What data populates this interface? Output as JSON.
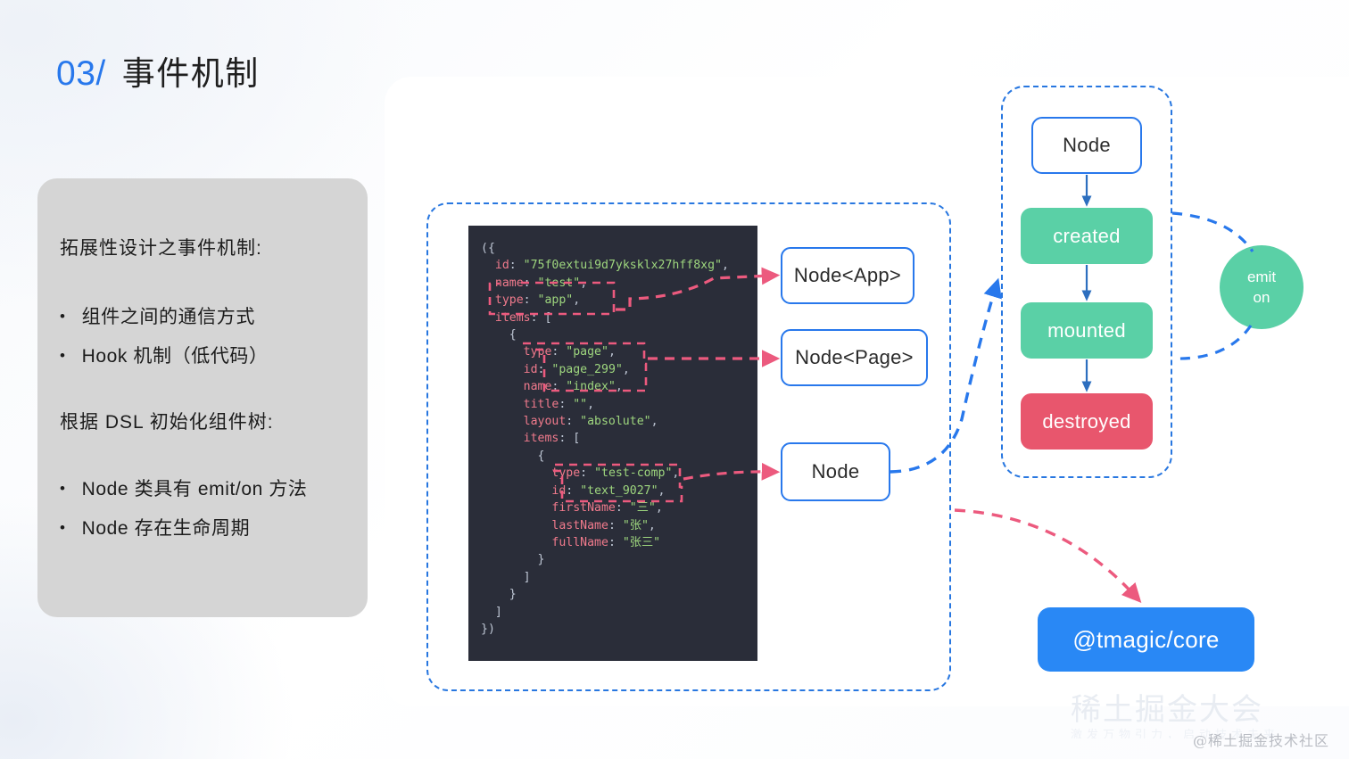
{
  "title": {
    "number": "03/",
    "text": "事件机制",
    "accent": "#2878ec"
  },
  "left_card": {
    "heading_1": "拓展性设计之事件机制:",
    "bullets_1": [
      "组件之间的通信方式",
      "Hook 机制（低代码）"
    ],
    "heading_2": "根据 DSL 初始化组件树:",
    "bullets_2": [
      "Node 类具有 emit/on 方法",
      "Node 存在生命周期"
    ],
    "bullet_glyph": "•"
  },
  "code": {
    "language": "javascript",
    "background": "#2a2d39",
    "key_color": "#f07a8c",
    "string_color": "#9ed67e",
    "punct_color": "#bfc7d5",
    "lines": [
      [
        {
          "t": "p",
          "v": "({"
        }
      ],
      [
        {
          "t": "p",
          "v": "  "
        },
        {
          "t": "k",
          "v": "id"
        },
        {
          "t": "p",
          "v": ": "
        },
        {
          "t": "s",
          "v": "\"75f0extui9d7yksklx27hff8xg\""
        },
        {
          "t": "p",
          "v": ","
        }
      ],
      [
        {
          "t": "p",
          "v": "  "
        },
        {
          "t": "k",
          "v": "name"
        },
        {
          "t": "p",
          "v": ": "
        },
        {
          "t": "s",
          "v": "\"test\""
        },
        {
          "t": "p",
          "v": ","
        }
      ],
      [
        {
          "t": "p",
          "v": "  "
        },
        {
          "t": "k",
          "v": "type"
        },
        {
          "t": "p",
          "v": ": "
        },
        {
          "t": "s",
          "v": "\"app\""
        },
        {
          "t": "p",
          "v": ","
        }
      ],
      [
        {
          "t": "p",
          "v": "  "
        },
        {
          "t": "k",
          "v": "items"
        },
        {
          "t": "p",
          "v": ": ["
        }
      ],
      [
        {
          "t": "p",
          "v": "    {"
        }
      ],
      [
        {
          "t": "p",
          "v": "      "
        },
        {
          "t": "k",
          "v": "type"
        },
        {
          "t": "p",
          "v": ": "
        },
        {
          "t": "s",
          "v": "\"page\""
        },
        {
          "t": "p",
          "v": ","
        }
      ],
      [
        {
          "t": "p",
          "v": "      "
        },
        {
          "t": "k",
          "v": "id"
        },
        {
          "t": "p",
          "v": ": "
        },
        {
          "t": "s",
          "v": "\"page_299\""
        },
        {
          "t": "p",
          "v": ","
        }
      ],
      [
        {
          "t": "p",
          "v": "      "
        },
        {
          "t": "k",
          "v": "name"
        },
        {
          "t": "p",
          "v": ": "
        },
        {
          "t": "s",
          "v": "\"index\""
        },
        {
          "t": "p",
          "v": ","
        }
      ],
      [
        {
          "t": "p",
          "v": "      "
        },
        {
          "t": "k",
          "v": "title"
        },
        {
          "t": "p",
          "v": ": "
        },
        {
          "t": "s",
          "v": "\"\""
        },
        {
          "t": "p",
          "v": ","
        }
      ],
      [
        {
          "t": "p",
          "v": "      "
        },
        {
          "t": "k",
          "v": "layout"
        },
        {
          "t": "p",
          "v": ": "
        },
        {
          "t": "s",
          "v": "\"absolute\""
        },
        {
          "t": "p",
          "v": ","
        }
      ],
      [
        {
          "t": "p",
          "v": "      "
        },
        {
          "t": "k",
          "v": "items"
        },
        {
          "t": "p",
          "v": ": ["
        }
      ],
      [
        {
          "t": "p",
          "v": "        {"
        }
      ],
      [
        {
          "t": "p",
          "v": "          "
        },
        {
          "t": "k",
          "v": "type"
        },
        {
          "t": "p",
          "v": ": "
        },
        {
          "t": "s",
          "v": "\"test-comp\""
        },
        {
          "t": "p",
          "v": ","
        }
      ],
      [
        {
          "t": "p",
          "v": "          "
        },
        {
          "t": "k",
          "v": "id"
        },
        {
          "t": "p",
          "v": ": "
        },
        {
          "t": "s",
          "v": "\"text_9027\""
        },
        {
          "t": "p",
          "v": ","
        }
      ],
      [
        {
          "t": "p",
          "v": "          "
        },
        {
          "t": "k",
          "v": "firstName"
        },
        {
          "t": "p",
          "v": ": "
        },
        {
          "t": "s",
          "v": "\"三\""
        },
        {
          "t": "p",
          "v": ","
        }
      ],
      [
        {
          "t": "p",
          "v": "          "
        },
        {
          "t": "k",
          "v": "lastName"
        },
        {
          "t": "p",
          "v": ": "
        },
        {
          "t": "s",
          "v": "\"张\""
        },
        {
          "t": "p",
          "v": ","
        }
      ],
      [
        {
          "t": "p",
          "v": "          "
        },
        {
          "t": "k",
          "v": "fullName"
        },
        {
          "t": "p",
          "v": ": "
        },
        {
          "t": "s",
          "v": "\"张三\""
        }
      ],
      [
        {
          "t": "p",
          "v": "        }"
        }
      ],
      [
        {
          "t": "p",
          "v": "      ]"
        }
      ],
      [
        {
          "t": "p",
          "v": "    }"
        }
      ],
      [
        {
          "t": "p",
          "v": "  ]"
        }
      ],
      [
        {
          "t": "p",
          "v": "})"
        }
      ]
    ]
  },
  "node_boxes": [
    {
      "id": "box-app",
      "label": "Node<App>"
    },
    {
      "id": "box-page",
      "label": "Node<Page>"
    },
    {
      "id": "box-node",
      "label": "Node"
    }
  ],
  "lifecycle": {
    "title_box": "Node",
    "stages": [
      {
        "label": "created",
        "color": "#5ad0a6"
      },
      {
        "label": "mounted",
        "color": "#5ad0a6"
      },
      {
        "label": "destroyed",
        "color": "#e8566d"
      }
    ]
  },
  "emit_circle": {
    "line1": "emit",
    "line2": "on",
    "color": "#5ad0a6"
  },
  "tmagic": {
    "label": "@tmagic/core",
    "color": "#2988f5"
  },
  "watermark": {
    "main": "稀土掘金大会",
    "sub": "激发万物引力，启动技术未来"
  },
  "footer": {
    "credit": "@稀土掘金技术社区"
  }
}
